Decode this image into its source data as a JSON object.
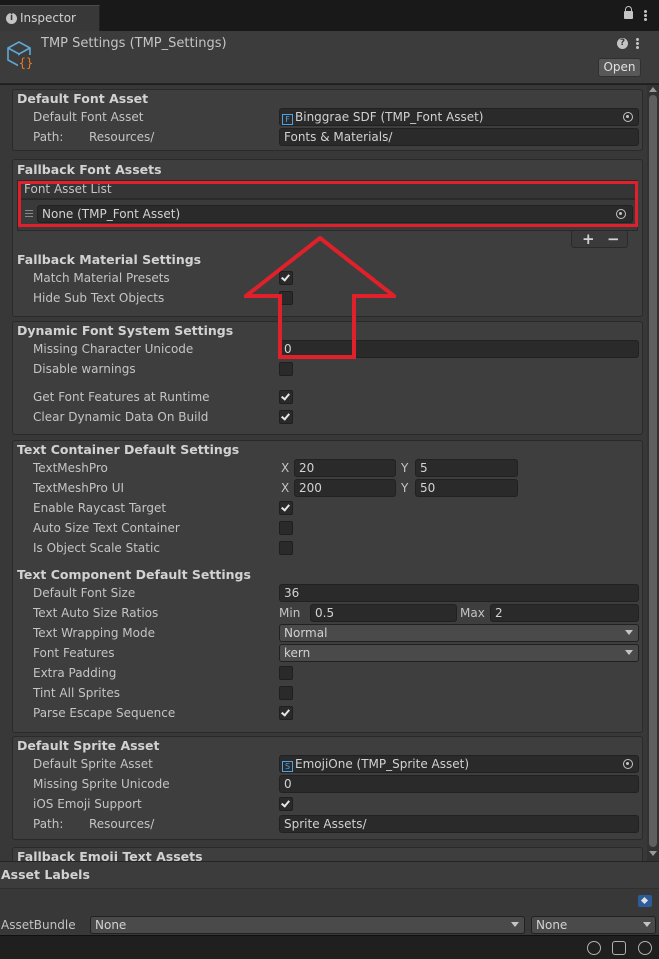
{
  "tab": {
    "label": "Inspector"
  },
  "header": {
    "title": "TMP Settings (TMP_Settings)",
    "open_label": "Open"
  },
  "default_font": {
    "title": "Default Font Asset",
    "asset_label": "Default Font Asset",
    "asset_value": "Binggrae SDF (TMP_Font Asset)",
    "path_label": "Path:",
    "path_prefix": "Resources/",
    "path_value": "Fonts & Materials/"
  },
  "fallback_fonts": {
    "title": "Fallback Font Assets",
    "list_header": "Font Asset List",
    "item0": "None (TMP_Font Asset)",
    "plus": "+",
    "minus": "−"
  },
  "fallback_material": {
    "title": "Fallback Material Settings",
    "match_presets": "Match Material Presets",
    "hide_sub": "Hide Sub Text Objects",
    "match_presets_checked": true,
    "hide_sub_checked": false
  },
  "dynamic_font": {
    "title": "Dynamic Font System Settings",
    "missing_unicode_label": "Missing Character Unicode",
    "missing_unicode_value": "0",
    "disable_warnings": "Disable warnings",
    "get_font_features": "Get Font Features at Runtime",
    "clear_dynamic": "Clear Dynamic Data On Build"
  },
  "text_container": {
    "title": "Text Container Default Settings",
    "tmp_label": "TextMeshPro",
    "tmp_x": "20",
    "tmp_y": "5",
    "tmp_ui_label": "TextMeshPro UI",
    "tmp_ui_x": "200",
    "tmp_ui_y": "50",
    "x": "X",
    "y": "Y",
    "raycast": "Enable Raycast Target",
    "auto_size": "Auto Size Text Container",
    "scale_static": "Is Object Scale Static"
  },
  "text_component": {
    "title": "Text Component Default Settings",
    "font_size_label": "Default Font Size",
    "font_size_value": "36",
    "ratios_label": "Text Auto Size Ratios",
    "min_label": "Min",
    "min_value": "0.5",
    "max_label": "Max",
    "max_value": "2",
    "wrap_label": "Text Wrapping Mode",
    "wrap_value": "Normal",
    "features_label": "Font Features",
    "features_value": "kern",
    "extra_padding": "Extra Padding",
    "tint_sprites": "Tint All Sprites",
    "parse_escape": "Parse Escape Sequence"
  },
  "sprite": {
    "title": "Default Sprite Asset",
    "asset_label": "Default Sprite Asset",
    "asset_value": "EmojiOne (TMP_Sprite Asset)",
    "missing_label": "Missing Sprite Unicode",
    "missing_value": "0",
    "ios_emoji": "iOS Emoji Support",
    "path_label": "Path:",
    "path_prefix": "Resources/",
    "path_value": "Sprite Assets/"
  },
  "fallback_emoji": {
    "title": "Fallback Emoji Text Assets"
  },
  "footer": {
    "asset_labels": "Asset Labels",
    "bundle_label": "AssetBundle",
    "bundle_value": "None",
    "variant_value": "None"
  },
  "colors": {
    "highlight": "#e0202a",
    "accent": "#4fa3e0"
  }
}
